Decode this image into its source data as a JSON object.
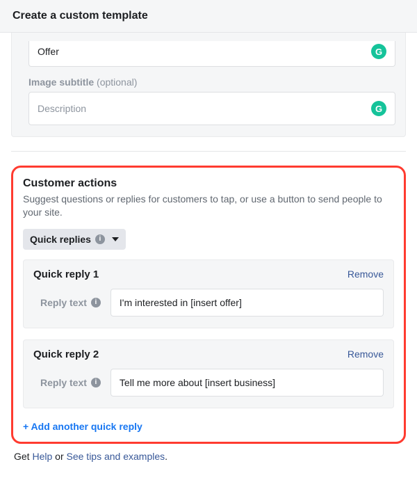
{
  "header": {
    "title": "Create a custom template"
  },
  "top": {
    "truncated_field_value": "Offer",
    "subtitle_label": "Image subtitle",
    "subtitle_optional": "(optional)",
    "subtitle_placeholder": "Description"
  },
  "actions": {
    "title": "Customer actions",
    "description": "Suggest questions or replies for customers to tap, or use a button to send people to your site.",
    "dropdown_label": "Quick replies",
    "replies": [
      {
        "title": "Quick reply 1",
        "label": "Reply text",
        "value": "I'm interested in [insert offer]",
        "remove": "Remove"
      },
      {
        "title": "Quick reply 2",
        "label": "Reply text",
        "value": "Tell me more about [insert business]",
        "remove": "Remove"
      }
    ],
    "add_label": "+ Add another quick reply"
  },
  "footer": {
    "prefix": "Get ",
    "help": "Help",
    "mid": " or ",
    "tips": "See tips and examples",
    "suffix": "."
  }
}
